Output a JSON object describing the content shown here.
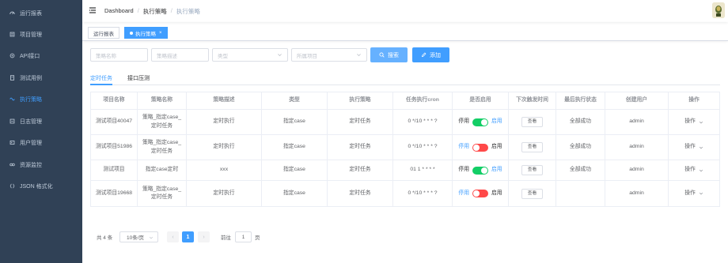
{
  "sidebar": {
    "items": [
      {
        "label": "运行报表",
        "icon": "dashboard-icon"
      },
      {
        "label": "项目管理",
        "icon": "project-icon"
      },
      {
        "label": "API接口",
        "icon": "api-icon"
      },
      {
        "label": "测试用例",
        "icon": "testcase-icon"
      },
      {
        "label": "执行策略",
        "icon": "strategy-icon",
        "active": true
      },
      {
        "label": "日志管理",
        "icon": "log-icon"
      },
      {
        "label": "用户管理",
        "icon": "user-icon"
      },
      {
        "label": "资源监控",
        "icon": "monitor-icon"
      },
      {
        "label": "JSON 格式化",
        "icon": "json-icon"
      }
    ]
  },
  "navbar": {
    "breadcrumb": [
      "Dashboard",
      "执行策略",
      "执行策略"
    ]
  },
  "tags": [
    {
      "label": "运行报表",
      "active": false
    },
    {
      "label": "执行策略",
      "active": true
    }
  ],
  "filters": {
    "name_placeholder": "策略名称",
    "desc_placeholder": "策略描述",
    "type_placeholder": "类型",
    "project_placeholder": "所属项目",
    "search_label": "搜索",
    "add_label": "添加"
  },
  "tabs": [
    {
      "label": "定时任务",
      "active": true
    },
    {
      "label": "接口压测",
      "active": false
    }
  ],
  "table": {
    "headers": [
      "项目名称",
      "策略名称",
      "策略描述",
      "类型",
      "执行策略",
      "任务执行cron",
      "是否启用",
      "下次触发时间",
      "最后执行状态",
      "创建用户",
      "操作"
    ],
    "rows": [
      {
        "project": "测试项目40047",
        "name": "策略_指定case_定时任务",
        "desc": "定时执行",
        "type": "指定case",
        "strategy": "定时任务",
        "cron": "0 */10 * * * ?",
        "enabled": true,
        "next": "查看",
        "status": "全部成功",
        "user": "admin",
        "op": "操作"
      },
      {
        "project": "测试项目51986",
        "name": "策略_指定case_定时任务",
        "desc": "定时执行",
        "type": "指定case",
        "strategy": "定时任务",
        "cron": "0 */10 * * * ?",
        "enabled": false,
        "next": "查看",
        "status": "全部成功",
        "user": "admin",
        "op": "操作"
      },
      {
        "project": "测试项目",
        "name": "指定case定时",
        "desc": "xxx",
        "type": "指定case",
        "strategy": "定时任务",
        "cron": "01 1 * * * *",
        "enabled": true,
        "next": "查看",
        "status": "全部成功",
        "user": "admin",
        "op": "操作"
      },
      {
        "project": "测试项目19668",
        "name": "策略_指定case_定时任务",
        "desc": "定时执行",
        "type": "指定case",
        "strategy": "定时任务",
        "cron": "0 */10 * * * ?",
        "enabled": false,
        "next": "查看",
        "status": "",
        "user": "admin",
        "op": "操作"
      }
    ],
    "switch_off_label": "停用",
    "switch_on_label": "启用"
  },
  "pagination": {
    "total": "共 4 条",
    "page_size": "10条/页",
    "current_page": "1",
    "goto_label": "前往",
    "goto_value": "1",
    "page_suffix": "页"
  },
  "colors": {
    "sidebar_bg": "#304156",
    "accent": "#409eff",
    "switch_on": "#13ce66",
    "switch_off": "#ff4949"
  }
}
